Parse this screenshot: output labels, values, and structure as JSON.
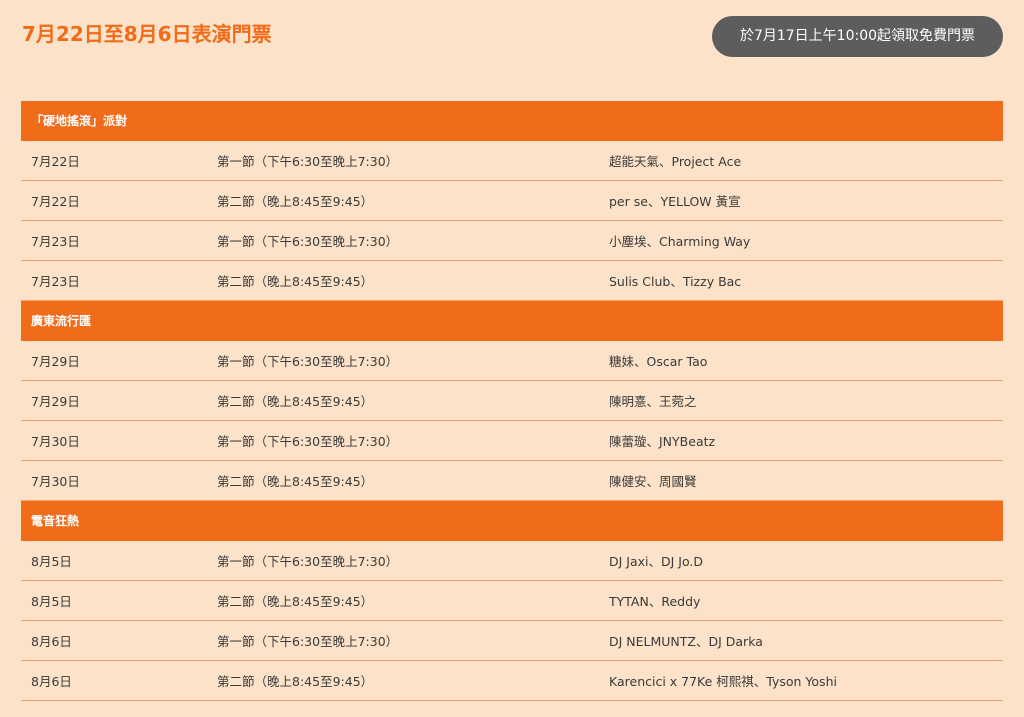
{
  "page": {
    "title": "7月22日至8月6日表演門票",
    "cta_label": "於7月17日上午10:00起領取免費門票"
  },
  "sections": [
    {
      "name": "「硬地搖滾」派對",
      "rows": [
        {
          "date": "7月22日",
          "session": "第一節（下午6:30至晚上7:30）",
          "artists": "超能天氣、Project Ace"
        },
        {
          "date": "7月22日",
          "session": "第二節（晚上8:45至9:45）",
          "artists": "per se、YELLOW 黃宣"
        },
        {
          "date": "7月23日",
          "session": "第一節（下午6:30至晚上7:30）",
          "artists": "小塵埃、Charming Way"
        },
        {
          "date": "7月23日",
          "session": "第二節（晚上8:45至9:45）",
          "artists": "Sulis Club、Tizzy Bac"
        }
      ]
    },
    {
      "name": "廣東流行匯",
      "rows": [
        {
          "date": "7月29日",
          "session": "第一節（下午6:30至晚上7:30）",
          "artists": "糖妹、Oscar Tao"
        },
        {
          "date": "7月29日",
          "session": "第二節（晚上8:45至9:45）",
          "artists": "陳明憙、王菀之"
        },
        {
          "date": "7月30日",
          "session": "第一節（下午6:30至晚上7:30）",
          "artists": "陳蕾璇、JNYBeatz"
        },
        {
          "date": "7月30日",
          "session": "第二節（晚上8:45至9:45）",
          "artists": "陳健安、周國賢"
        }
      ]
    },
    {
      "name": "電音狂熱",
      "rows": [
        {
          "date": "8月5日",
          "session": "第一節（下午6:30至晚上7:30）",
          "artists": "DJ Jaxi、DJ Jo.D"
        },
        {
          "date": "8月5日",
          "session": "第二節（晚上8:45至9:45）",
          "artists": "TYTAN、Reddy"
        },
        {
          "date": "8月6日",
          "session": "第一節（下午6:30至晚上7:30）",
          "artists": "DJ NELMUNTZ、DJ Darka"
        },
        {
          "date": "8月6日",
          "session": "第二節（晚上8:45至9:45）",
          "artists": "Karencici x 77Ke 柯熙祺、Tyson Yoshi"
        }
      ]
    }
  ],
  "colors": {
    "background": "#fce2c9",
    "accent": "#f06b1a",
    "row_divider": "#f4a06a",
    "button_bg": "#5d5d5d"
  }
}
